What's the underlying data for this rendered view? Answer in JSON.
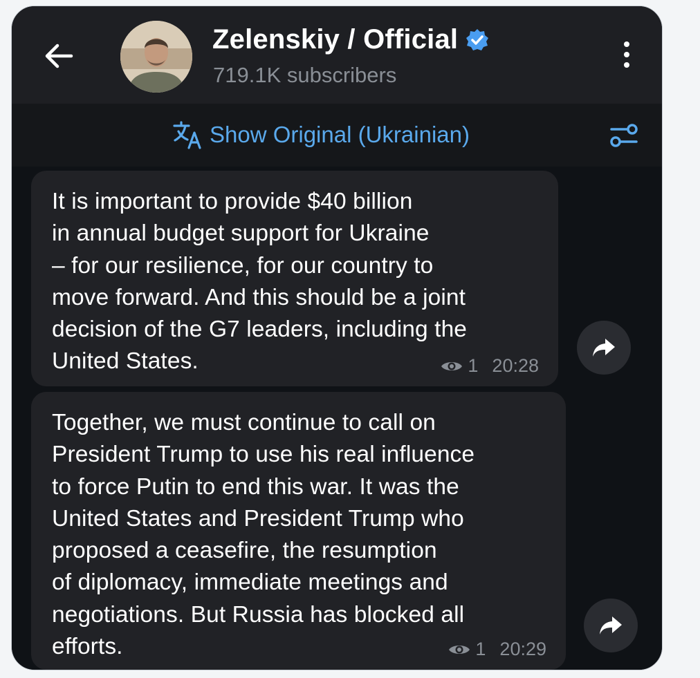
{
  "header": {
    "channel_title": "Zelenskiy / Official",
    "subscribers": "719.1K subscribers",
    "verified": true
  },
  "translate_bar": {
    "label": "Show Original (Ukrainian)"
  },
  "messages": [
    {
      "text": "It is important to provide $40 billion\nin annual budget support for Ukraine\n– for our resilience, for our country to\nmove forward. And this should be a joint\ndecision of the G7 leaders, including the\nUnited States.",
      "views": "1",
      "time": "20:28"
    },
    {
      "text": "Together, we must continue to call on\nPresident Trump to use his real influence\nto force Putin to end this war. It was the\nUnited States and President Trump who\nproposed a ceasefire, the resumption\nof diplomacy, immediate meetings and\nnegotiations. But Russia has blocked all\nefforts.",
      "views": "1",
      "time": "20:29"
    }
  ],
  "colors": {
    "accent": "#5aa9ec",
    "verified_badge": "#4a9df0",
    "bubble": "#212226",
    "background": "#0f1216"
  },
  "icons": [
    "back-arrow-icon",
    "verified-badge-icon",
    "more-vert-icon",
    "translate-icon",
    "tune-icon",
    "eye-icon",
    "share-icon"
  ]
}
